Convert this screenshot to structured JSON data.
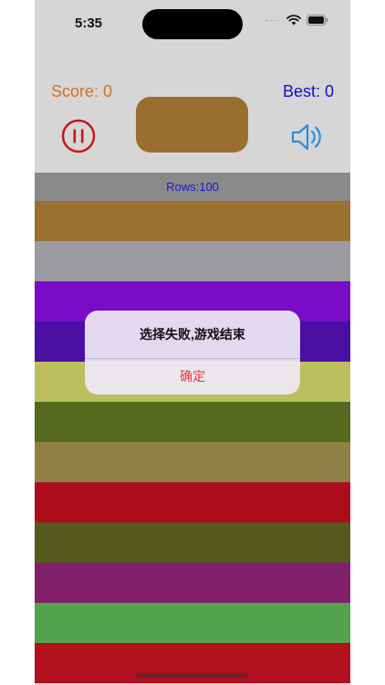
{
  "status_bar": {
    "time": "5:35",
    "dots": "····"
  },
  "header": {
    "score_text": "Score: 0",
    "best_text": "Best: 0",
    "center_block_color": "#9a6e2f",
    "pause_icon": "pause-circle-icon",
    "sound_icon": "speaker-icon"
  },
  "rows_label": "Rows:100",
  "rows": [
    {
      "color": "#9a6f2f"
    },
    {
      "color": "#9b9ba0"
    },
    {
      "color": "#7a0cc7"
    },
    {
      "color": "#4a0fa3"
    },
    {
      "color": "#bcbf5e"
    },
    {
      "color": "#56691f"
    },
    {
      "color": "#8f8045"
    },
    {
      "color": "#ad0c1c"
    },
    {
      "color": "#54591c"
    },
    {
      "color": "#811f6a"
    },
    {
      "color": "#53a24d"
    },
    {
      "color": "#b3101e"
    }
  ],
  "dialog": {
    "title": "选择失败,游戏结束",
    "confirm_label": "确定"
  }
}
